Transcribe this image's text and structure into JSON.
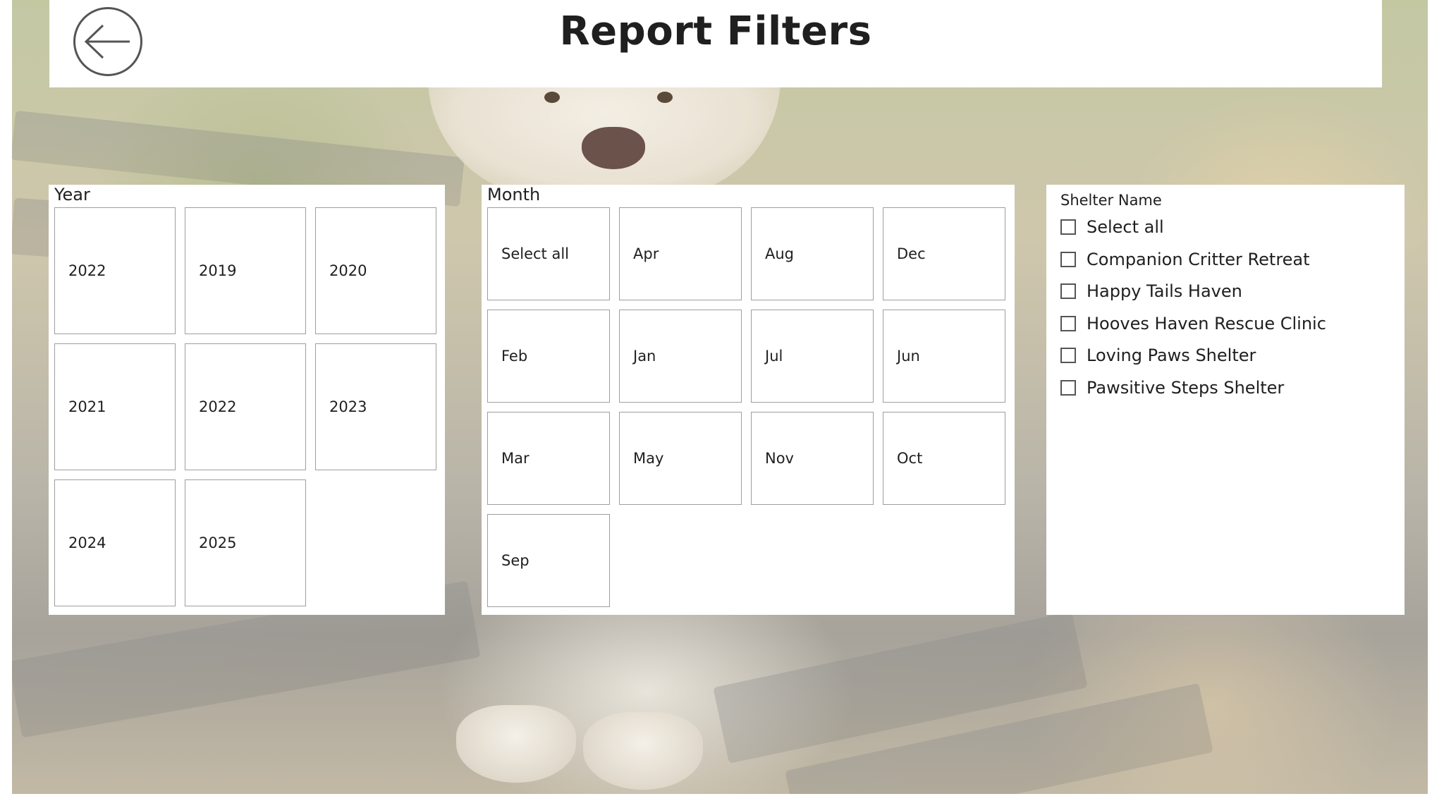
{
  "header": {
    "title": "Report Filters",
    "back_icon": "arrow-left-icon"
  },
  "year_slicer": {
    "title": "Year",
    "options": [
      "2022",
      "2019",
      "2020",
      "2021",
      "2022",
      "2023",
      "2024",
      "2025"
    ]
  },
  "month_slicer": {
    "title": "Month",
    "options": [
      "Select all",
      "Apr",
      "Aug",
      "Dec",
      "Feb",
      "Jan",
      "Jul",
      "Jun",
      "Mar",
      "May",
      "Nov",
      "Oct",
      "Sep"
    ]
  },
  "shelter_slicer": {
    "title": "Shelter Name",
    "options": [
      {
        "label": "Select all",
        "checked": false
      },
      {
        "label": "Companion Critter Retreat",
        "checked": false
      },
      {
        "label": "Happy Tails Haven",
        "checked": false
      },
      {
        "label": "Hooves Haven Rescue Clinic",
        "checked": false
      },
      {
        "label": "Loving Paws Shelter",
        "checked": false
      },
      {
        "label": "Pawsitive Steps Shelter",
        "checked": false
      }
    ]
  },
  "background": {
    "description_icon": "dog-on-bench-photo"
  }
}
